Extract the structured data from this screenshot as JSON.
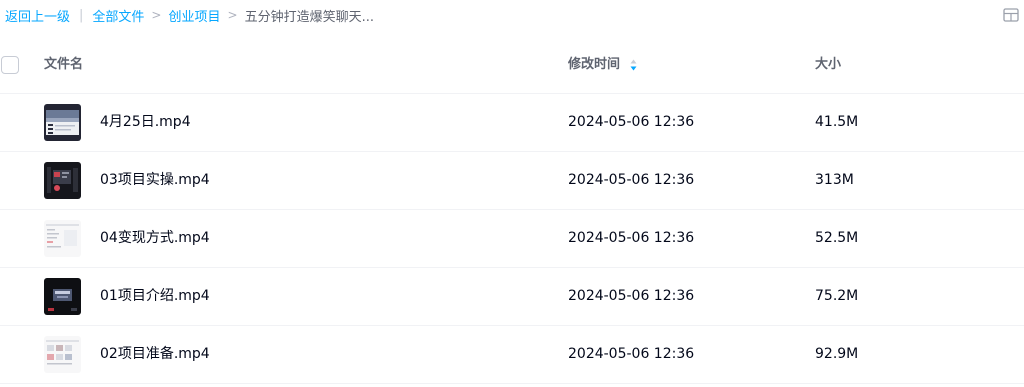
{
  "breadcrumb": {
    "back": "返回上一级",
    "all_files": "全部文件",
    "folder": "创业项目",
    "current": "五分钟打造爆笑聊天..."
  },
  "table": {
    "col_name": "文件名",
    "col_time": "修改时间",
    "col_size": "大小"
  },
  "files": [
    {
      "name": "4月25日.mp4",
      "time": "2024-05-06 12:36",
      "size": "41.5M"
    },
    {
      "name": "03项目实操.mp4",
      "time": "2024-05-06 12:36",
      "size": "313M"
    },
    {
      "name": "04变现方式.mp4",
      "time": "2024-05-06 12:36",
      "size": "52.5M"
    },
    {
      "name": "01项目介绍.mp4",
      "time": "2024-05-06 12:36",
      "size": "75.2M"
    },
    {
      "name": "02项目准备.mp4",
      "time": "2024-05-06 12:36",
      "size": "92.9M"
    }
  ],
  "colors": {
    "link": "#06a7ff",
    "text": "#03081a",
    "header_text": "#5f6470"
  },
  "icons": {
    "view_toggle": "grid-view-icon",
    "sort": "sort-icon"
  }
}
